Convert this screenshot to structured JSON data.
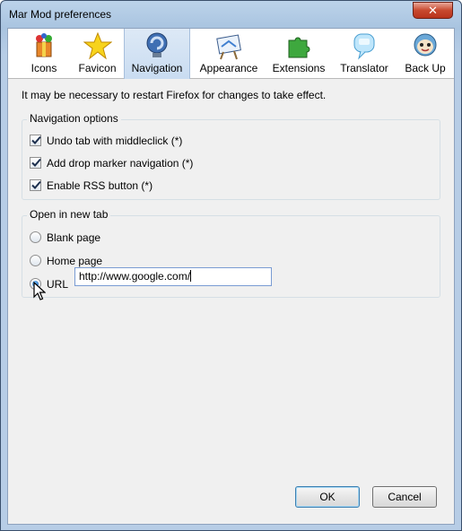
{
  "window": {
    "title": "Mar Mod preferences",
    "close_glyph": "✕"
  },
  "toolbar": {
    "items": [
      {
        "label": "Icons",
        "icon": "gift-box-icon"
      },
      {
        "label": "Favicon",
        "icon": "star-icon"
      },
      {
        "label": "Navigation",
        "icon": "navigation-icon",
        "active": true
      },
      {
        "label": "Appearance",
        "icon": "easel-icon"
      },
      {
        "label": "Extensions",
        "icon": "puzzle-icon"
      },
      {
        "label": "Translator",
        "icon": "speech-bubble-icon"
      },
      {
        "label": "Back Up",
        "icon": "backup-face-icon"
      }
    ]
  },
  "notice": "It may be necessary to restart Firefox for changes to take effect.",
  "navigation_options": {
    "title": "Navigation options",
    "items": [
      {
        "label": "Undo tab with middleclick (*)",
        "checked": true
      },
      {
        "label": "Add drop marker navigation (*)",
        "checked": true
      },
      {
        "label": "Enable RSS button (*)",
        "checked": true
      }
    ]
  },
  "open_in_new_tab": {
    "title": "Open in new tab",
    "options": [
      {
        "label": "Blank page",
        "selected": false
      },
      {
        "label": "Home page",
        "selected": false
      },
      {
        "label": "URL",
        "selected": true
      }
    ],
    "url_value": "http://www.google.com/"
  },
  "buttons": {
    "ok": "OK",
    "cancel": "Cancel"
  },
  "colors": {
    "accent": "#1a5fb4",
    "active_tab": "#c9dcf1"
  }
}
